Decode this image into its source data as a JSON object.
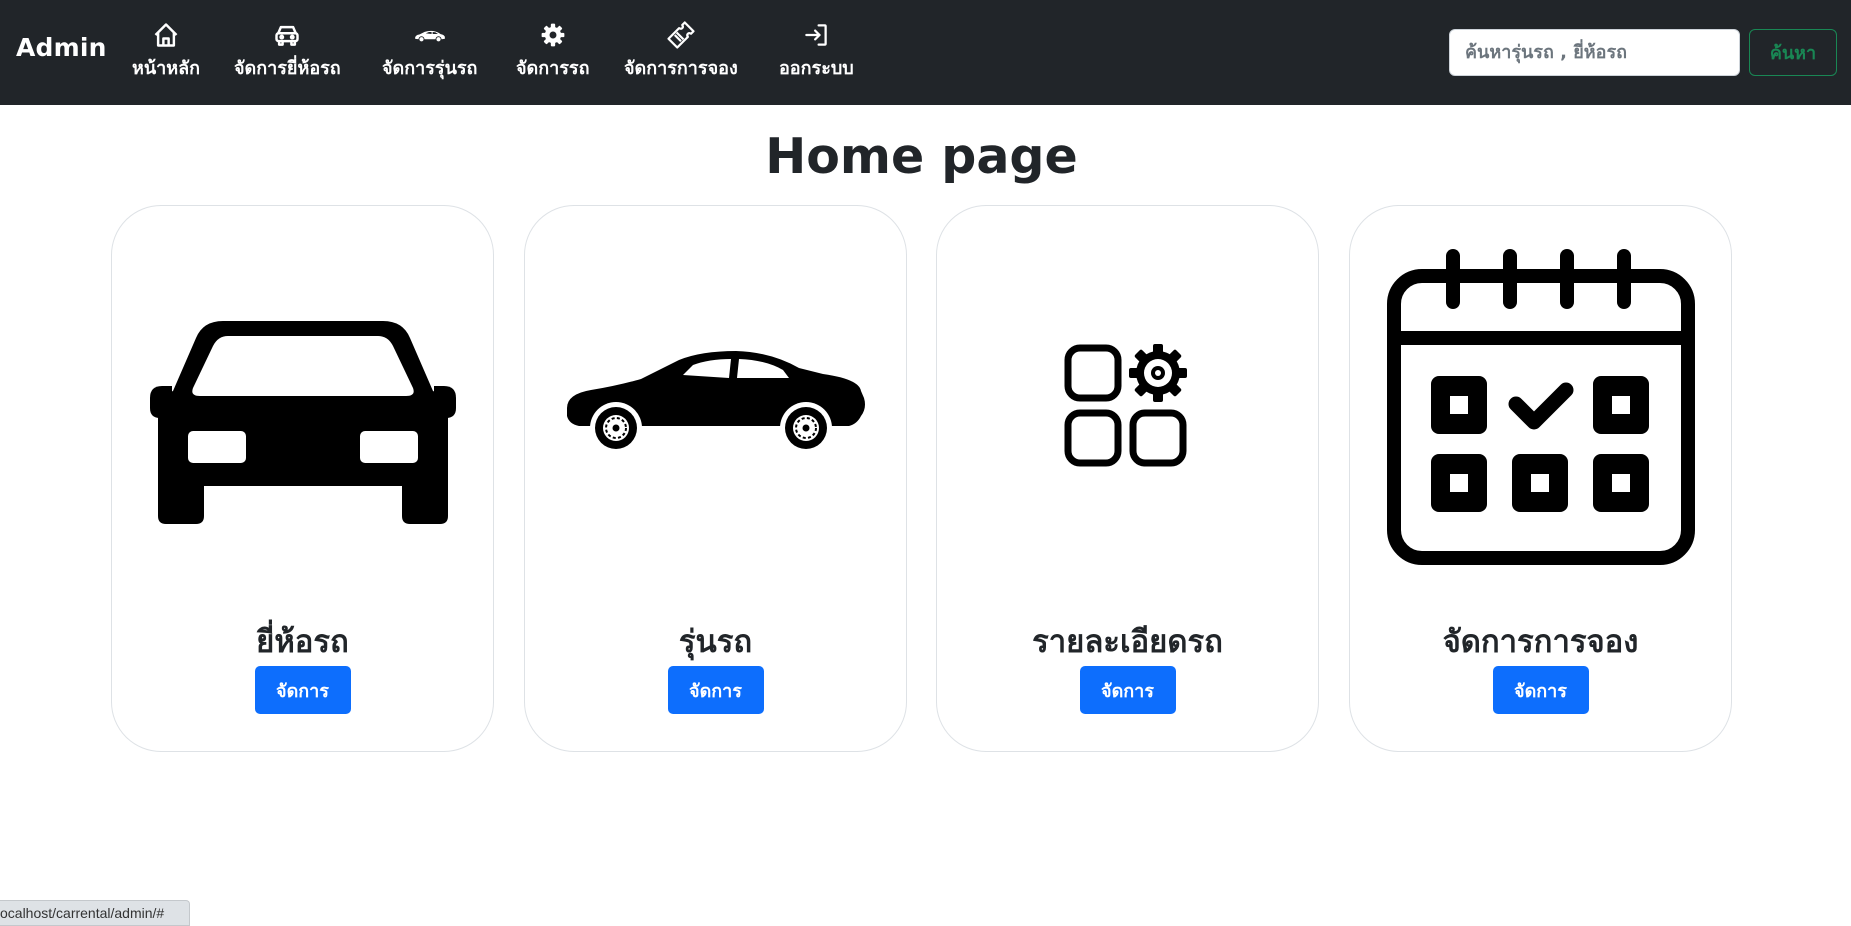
{
  "navbar": {
    "brand": "Admin",
    "items": [
      {
        "label": "หน้าหลัก",
        "icon": "house-icon"
      },
      {
        "label": "จัดการยี่ห้อรถ",
        "icon": "car-front-icon"
      },
      {
        "label": "จัดการรุ่นรถ",
        "icon": "car-side-icon"
      },
      {
        "label": "จัดการรถ",
        "icon": "gear-icon"
      },
      {
        "label": "จัดการการจอง",
        "icon": "ticket-icon"
      },
      {
        "label": "ออกระบบ",
        "icon": "logout-icon"
      }
    ],
    "search_placeholder": "ค้นหารุ่นรถ , ยี่ห้อรถ",
    "search_value": "",
    "search_button": "ค้นหา"
  },
  "main": {
    "title": "Home page",
    "cards": [
      {
        "title": "ยี่ห้อรถ",
        "button": "จัดการ",
        "icon": "car-front-icon"
      },
      {
        "title": "รุ่นรถ",
        "button": "จัดการ",
        "icon": "sedan-icon"
      },
      {
        "title": "รายละเอียดรถ",
        "button": "จัดการ",
        "icon": "apps-settings-icon"
      },
      {
        "title": "จัดการการจอง",
        "button": "จัดการ",
        "icon": "calendar-check-icon"
      }
    ]
  },
  "status_bar": {
    "url": "ocalhost/carrental/admin/#"
  },
  "colors": {
    "navbar_bg": "#212529",
    "primary": "#0d6efd",
    "success": "#198754",
    "text": "#212529"
  }
}
